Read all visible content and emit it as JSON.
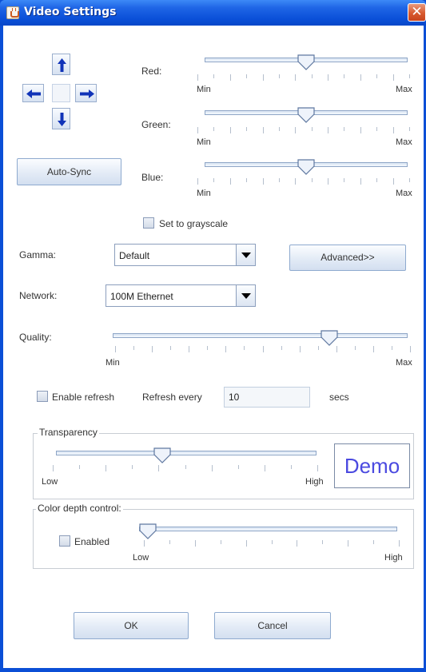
{
  "window": {
    "title": "Video Settings",
    "close_glyph": "✕"
  },
  "arrows": [
    "up-arrow-icon",
    "left-arrow-icon",
    "right-arrow-icon",
    "down-arrow-icon"
  ],
  "auto_sync_label": "Auto-Sync",
  "color_sliders": [
    {
      "label": "Red:",
      "min_label": "Min",
      "max_label": "Max",
      "value": 0.5
    },
    {
      "label": "Green:",
      "min_label": "Min",
      "max_label": "Max",
      "value": 0.5
    },
    {
      "label": "Blue:",
      "min_label": "Min",
      "max_label": "Max",
      "value": 0.5
    }
  ],
  "grayscale": {
    "label": "Set to grayscale",
    "checked": false
  },
  "gamma": {
    "label": "Gamma:",
    "value": "Default"
  },
  "advanced_label": "Advanced>>",
  "network": {
    "label": "Network:",
    "value": "100M Ethernet"
  },
  "quality": {
    "label": "Quality:",
    "min_label": "Min",
    "max_label": "Max",
    "value": 0.75
  },
  "refresh": {
    "checkbox_label": "Enable refresh",
    "every_label": "Refresh every",
    "value": "10",
    "unit": "secs",
    "checked": false
  },
  "transparency": {
    "title": "Transparency",
    "low_label": "Low",
    "high_label": "High",
    "value": 0.4,
    "demo_text": "Demo"
  },
  "color_depth": {
    "title": "Color depth control:",
    "enabled_label": "Enabled",
    "checked": false,
    "low_label": "Low",
    "high_label": "High",
    "value": 0.0
  },
  "ok_label": "OK",
  "cancel_label": "Cancel",
  "colors": {
    "title_bar": "#0a4fd8",
    "demo_text": "#4b4ae0",
    "arrow_blue": "#1033b8"
  }
}
